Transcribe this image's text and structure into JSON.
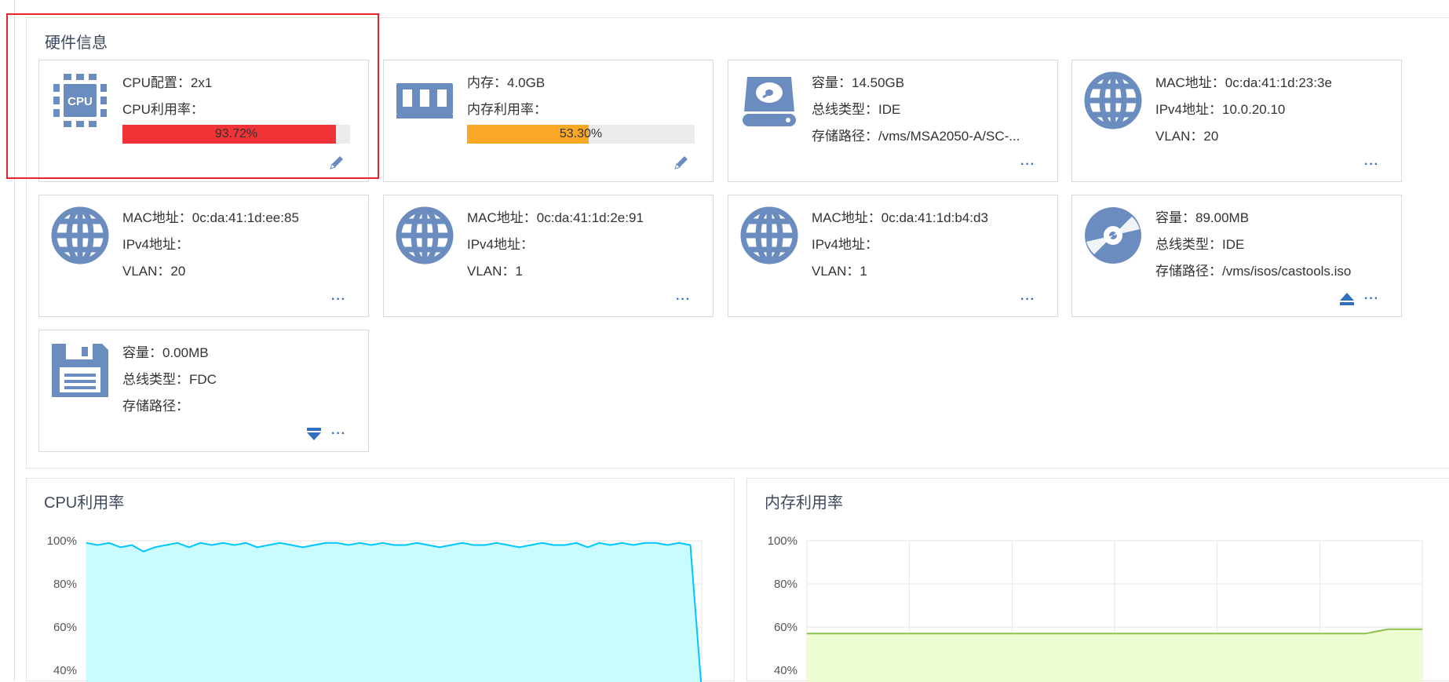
{
  "hardware": {
    "title": "硬件信息",
    "cards": [
      {
        "type": "cpu",
        "lines": [
          "CPU配置：2x1",
          "CPU利用率："
        ],
        "progress": {
          "value": 0.9372,
          "label": "93.72%",
          "color": "#f03337"
        }
      },
      {
        "type": "memory",
        "lines": [
          "内存：4.0GB",
          "内存利用率："
        ],
        "progress": {
          "value": 0.533,
          "label": "53.30%",
          "color": "#f9a825"
        }
      },
      {
        "type": "disk",
        "lines": [
          "容量：14.50GB",
          "总线类型：IDE",
          "存储路径：/vms/MSA2050-A/SC-..."
        ]
      },
      {
        "type": "network",
        "lines": [
          "MAC地址：0c:da:41:1d:23:3e",
          "IPv4地址：10.0.20.10",
          "VLAN：20"
        ]
      },
      {
        "type": "network",
        "lines": [
          "MAC地址：0c:da:41:1d:ee:85",
          "IPv4地址：",
          "VLAN：20"
        ]
      },
      {
        "type": "network",
        "lines": [
          "MAC地址：0c:da:41:1d:2e:91",
          "IPv4地址：",
          "VLAN：1"
        ]
      },
      {
        "type": "network",
        "lines": [
          "MAC地址：0c:da:41:1d:b4:d3",
          "IPv4地址：",
          "VLAN：1"
        ]
      },
      {
        "type": "cdrom",
        "lines": [
          "容量：89.00MB",
          "总线类型：IDE",
          "存储路径：/vms/isos/castools.iso"
        ]
      },
      {
        "type": "floppy",
        "lines": [
          "容量：0.00MB",
          "总线类型：FDC",
          "存储路径："
        ]
      }
    ],
    "icon_color": "#6b8cbf",
    "more_label": "···"
  },
  "charts": {
    "cpu": {
      "title": "CPU利用率"
    },
    "mem": {
      "title": "内存利用率"
    }
  },
  "chart_data": [
    {
      "type": "area",
      "title": "CPU利用率",
      "yticks": [
        "100%",
        "80%",
        "60%",
        "40%"
      ],
      "ylim": [
        0,
        100
      ],
      "grid": true,
      "color": "#00c6ff",
      "fill": "#c9fbff",
      "values": [
        99,
        98,
        99,
        97,
        98,
        95,
        97,
        98,
        99,
        97,
        99,
        98,
        99,
        98,
        99,
        97,
        98,
        99,
        98,
        97,
        98,
        99,
        99,
        98,
        99,
        98,
        99,
        98,
        98,
        99,
        98,
        97,
        98,
        99,
        98,
        98,
        99,
        98,
        97,
        98,
        99,
        98,
        98,
        99,
        97,
        99,
        98,
        99,
        98,
        99,
        99,
        98,
        99,
        98,
        30
      ]
    },
    {
      "type": "area",
      "title": "内存利用率",
      "yticks": [
        "100%",
        "80%",
        "60%",
        "40%"
      ],
      "ylim": [
        0,
        100
      ],
      "grid": true,
      "color": "#8bc34a",
      "fill": "#eefcd1",
      "values": [
        57,
        57,
        57,
        57,
        57,
        57,
        57,
        57,
        57,
        57,
        57,
        57,
        57,
        57,
        57,
        57,
        57,
        57,
        57,
        57,
        57,
        57,
        57,
        57,
        57,
        57,
        57,
        57,
        57,
        57,
        57,
        57,
        57,
        57,
        57,
        57,
        57,
        57,
        57,
        57,
        57,
        57,
        57,
        57,
        57,
        57,
        57,
        57,
        57,
        57,
        58,
        59,
        59,
        59,
        59
      ]
    }
  ]
}
